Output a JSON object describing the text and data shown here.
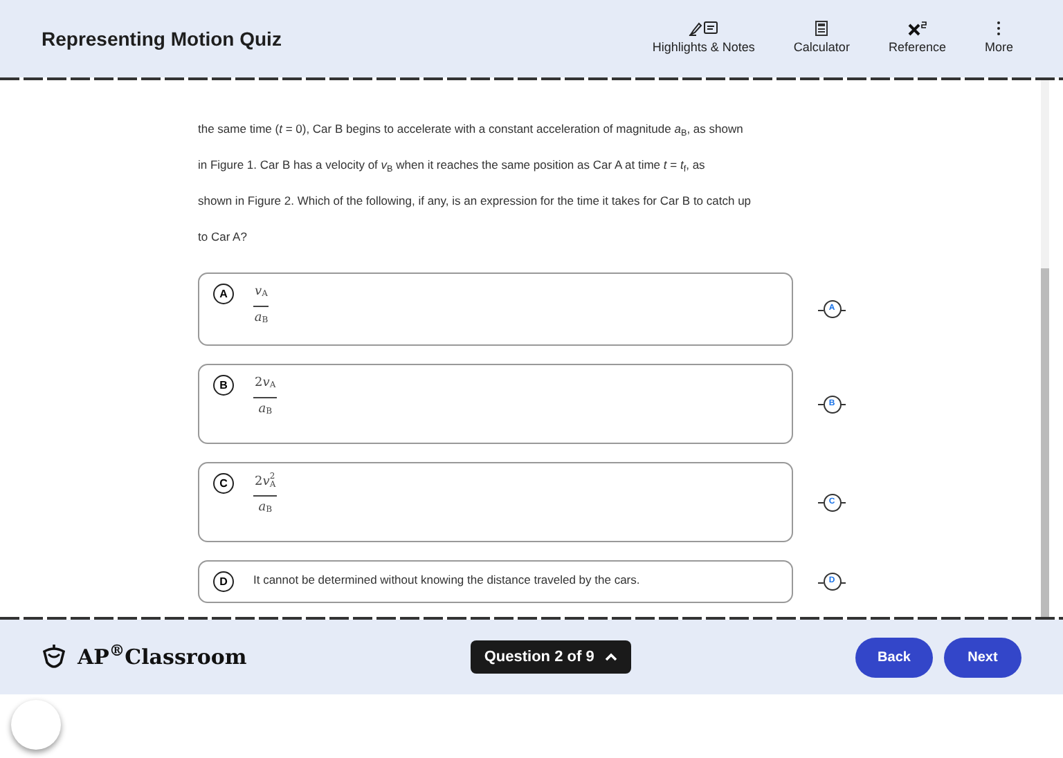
{
  "header": {
    "title": "Representing Motion Quiz",
    "tools": [
      {
        "kind": "highlights",
        "label": "Highlights & Notes"
      },
      {
        "kind": "calculator",
        "label": "Calculator"
      },
      {
        "kind": "reference",
        "label": "Reference"
      },
      {
        "kind": "more",
        "label": "More"
      }
    ]
  },
  "question": {
    "lines": [
      "the same time (*t* = 0), Car B begins to accelerate with a constant acceleration of magnitude *a*$_{B}$, as shown",
      "in Figure 1. Car B has a velocity of *v*$_{B}$ when it reaches the same position as Car A at time *t* = *t*$_{f}$, as",
      "shown in Figure 2. Which of the following, if any, is an expression for the time it takes for Car B to catch up",
      "to Car A?"
    ]
  },
  "options": [
    {
      "letter": "A",
      "kind": "fraction",
      "numerator": {
        "variable": "v",
        "subscript": "A"
      },
      "denominator": {
        "variable": "a",
        "subscript": "B"
      },
      "selected": false,
      "crossout_letter": "A"
    },
    {
      "letter": "B",
      "kind": "fraction",
      "numerator": {
        "coefficient": "2",
        "variable": "v",
        "subscript": "A"
      },
      "denominator": {
        "variable": "a",
        "subscript": "B"
      },
      "selected": false,
      "crossout_letter": "B"
    },
    {
      "letter": "C",
      "kind": "fraction",
      "numerator": {
        "coefficient": "2",
        "variable": "v",
        "superscript": "2",
        "subscript": "A"
      },
      "denominator": {
        "variable": "a",
        "subscript": "B"
      },
      "selected": false,
      "crossout_letter": "C"
    },
    {
      "letter": "D",
      "kind": "text",
      "text": "It cannot be determined without knowing the distance traveled by the cars.",
      "selected": false,
      "crossout_letter": "D"
    }
  ],
  "footer": {
    "logo": "AP",
    "logo_mark": "®",
    "logo_rest": "Classroom",
    "question_nav": "Question 2 of 9",
    "back": "Back",
    "next": "Next"
  }
}
